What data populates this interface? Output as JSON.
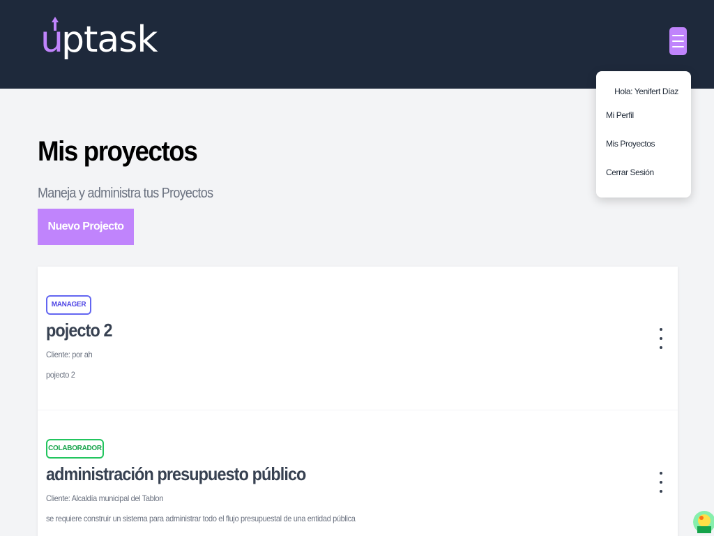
{
  "header": {
    "logo_text": "uptask",
    "logo_accent": "#c084fc",
    "background": "#1e293b",
    "menu_icon": "hamburger-icon"
  },
  "user_menu": {
    "greeting": "Hola: Yenifert Díaz",
    "items": [
      {
        "label": "Mi Perfil"
      },
      {
        "label": "Mis Proyectos"
      },
      {
        "label": "Cerrar Sesión"
      }
    ]
  },
  "main": {
    "title": "Mis proyectos",
    "subtitle": "Maneja y administra tus Proyectos",
    "new_project_label": "Nuevo Projecto"
  },
  "projects": [
    {
      "role": "MANAGER",
      "role_color": "#6366f1",
      "name": "pojecto 2",
      "client": "Cliente: por ah",
      "description": "pojecto 2",
      "options_icon": "more-vertical-icon"
    },
    {
      "role": "COLABORADOR",
      "role_color": "#22c55e",
      "name": "administración presupuesto público",
      "client": "Cliente: Alcaldía municipal del Tablon",
      "description": "se requiere construir un sistema para administrar todo el flujo presupuestal de una entidad pública",
      "options_icon": "more-vertical-icon"
    }
  ]
}
